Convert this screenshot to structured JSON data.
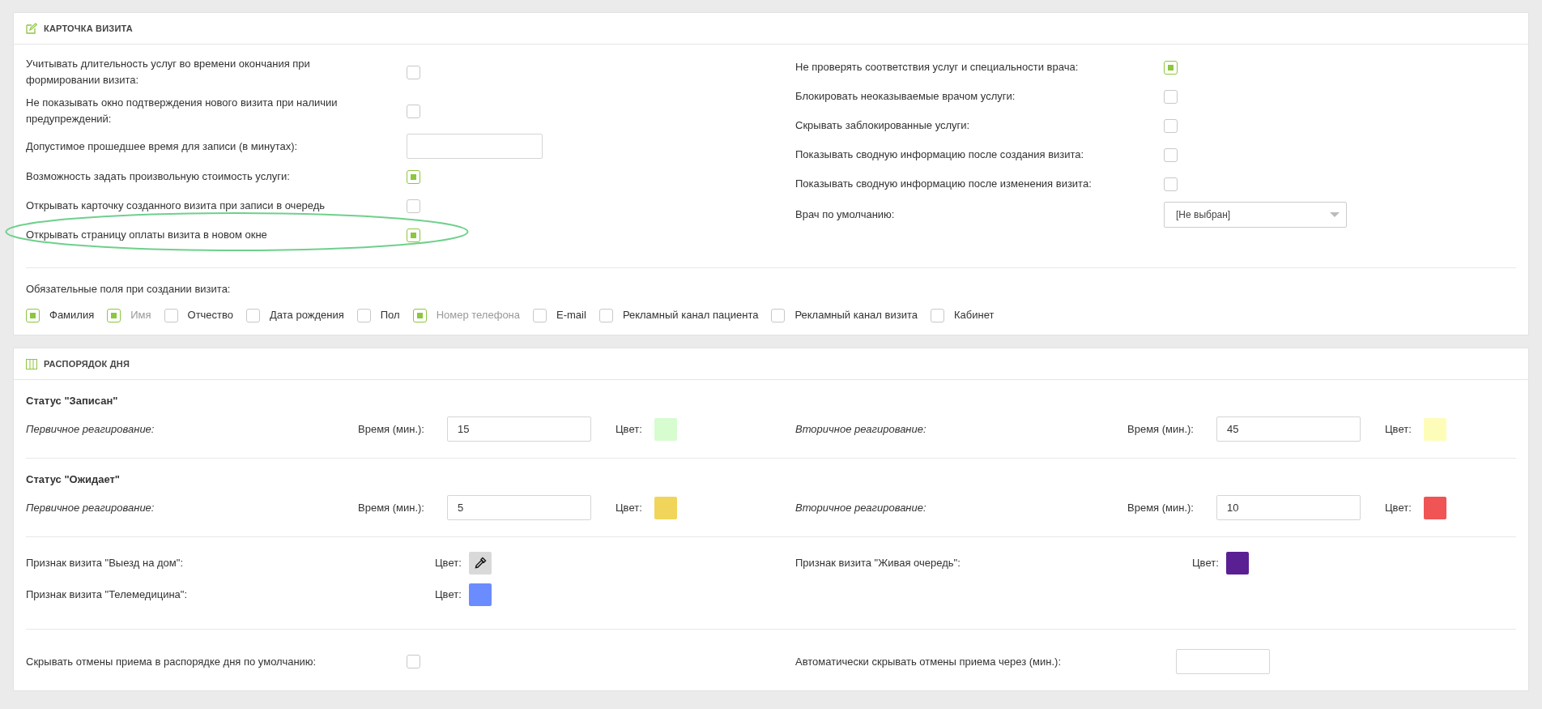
{
  "visit_card": {
    "title": "КАРТОЧКА ВИЗИТА",
    "left_settings": [
      {
        "kind": "checkbox",
        "label": "Учитывать длительность услуг во времени окончания при формировании визита:",
        "checked": false,
        "highlighted": false
      },
      {
        "kind": "checkbox",
        "label": "Не показывать окно подтверждения нового визита при наличии предупреждений:",
        "checked": false,
        "highlighted": false
      },
      {
        "kind": "input",
        "label": "Допустимое прошедшее время для записи (в минутах):",
        "highlighted": false
      },
      {
        "kind": "checkbox",
        "label": "Возможность задать произвольную стоимость услуги:",
        "checked": true,
        "highlighted": false
      },
      {
        "kind": "checkbox",
        "label": "Открывать карточку созданного визита при записи в очередь",
        "checked": false,
        "highlighted": false
      },
      {
        "kind": "checkbox",
        "label": "Открывать страницу оплаты визита в новом окне",
        "checked": true,
        "highlighted": true
      }
    ],
    "right_settings": [
      {
        "kind": "checkbox",
        "label": "Не проверять соответствия услуг и специальности врача:",
        "checked": true,
        "highlighted": false
      },
      {
        "kind": "checkbox",
        "label": "Блокировать неоказываемые врачом услуги:",
        "checked": false,
        "highlighted": false
      },
      {
        "kind": "checkbox",
        "label": "Скрывать заблокированные услуги:",
        "checked": false,
        "highlighted": false
      },
      {
        "kind": "checkbox",
        "label": "Показывать сводную информацию после создания визита:",
        "checked": false,
        "highlighted": false
      },
      {
        "kind": "checkbox",
        "label": "Показывать сводную информацию после изменения визита:",
        "checked": false,
        "highlighted": false
      },
      {
        "kind": "select",
        "label": "Врач по умолчанию:",
        "value": "[Не выбран]",
        "highlighted": false
      }
    ],
    "required_fields": {
      "label": "Обязательные поля при создании визита:",
      "items": [
        {
          "label": "Фамилия",
          "checked": true,
          "disabled": false
        },
        {
          "label": "Имя",
          "checked": true,
          "disabled": true
        },
        {
          "label": "Отчество",
          "checked": false,
          "disabled": false
        },
        {
          "label": "Дата рождения",
          "checked": false,
          "disabled": false
        },
        {
          "label": "Пол",
          "checked": false,
          "disabled": false
        },
        {
          "label": "Номер телефона",
          "checked": true,
          "disabled": true
        },
        {
          "label": "E-mail",
          "checked": false,
          "disabled": false
        },
        {
          "label": "Рекламный канал пациента",
          "checked": false,
          "disabled": false
        },
        {
          "label": "Рекламный канал визита",
          "checked": false,
          "disabled": false
        },
        {
          "label": "Кабинет",
          "checked": false,
          "disabled": false
        }
      ]
    }
  },
  "schedule": {
    "title": "РАСПОРЯДОК ДНЯ",
    "statuses": [
      {
        "title": "Статус \"Записан\"",
        "reactions": [
          {
            "label": "Первичное реагирование:",
            "time_label": "Время (мин.):",
            "time": "15",
            "color_label": "Цвет:",
            "color": "#d6fcd0"
          },
          {
            "label": "Вторичное реагирование:",
            "time_label": "Время (мин.):",
            "time": "45",
            "color_label": "Цвет:",
            "color": "#fdfdb9"
          }
        ]
      },
      {
        "title": "Статус \"Ожидает\"",
        "reactions": [
          {
            "label": "Первичное реагирование:",
            "time_label": "Время (мин.):",
            "time": "5",
            "color_label": "Цвет:",
            "color": "#f0d55a"
          },
          {
            "label": "Вторичное реагирование:",
            "time_label": "Время (мин.):",
            "time": "10",
            "color_label": "Цвет:",
            "color": "#f05454"
          }
        ]
      }
    ],
    "markers": [
      {
        "label": "Признак визита \"Выезд на дом\":",
        "color_label": "Цвет:"
      },
      {
        "label": "Признак визита \"Живая очередь\":",
        "color_label": "Цвет:",
        "color": "#5b1f94"
      },
      {
        "label": "Признак визита \"Телемедицина\":",
        "color_label": "Цвет:",
        "color": "#6b8cff"
      }
    ],
    "bottom": [
      {
        "kind": "checkbox",
        "label": "Скрывать отмены приема в распорядке дня по умолчанию:",
        "checked": false
      },
      {
        "kind": "input",
        "label": "Автоматически скрывать отмены приема через (мин.):"
      }
    ]
  }
}
